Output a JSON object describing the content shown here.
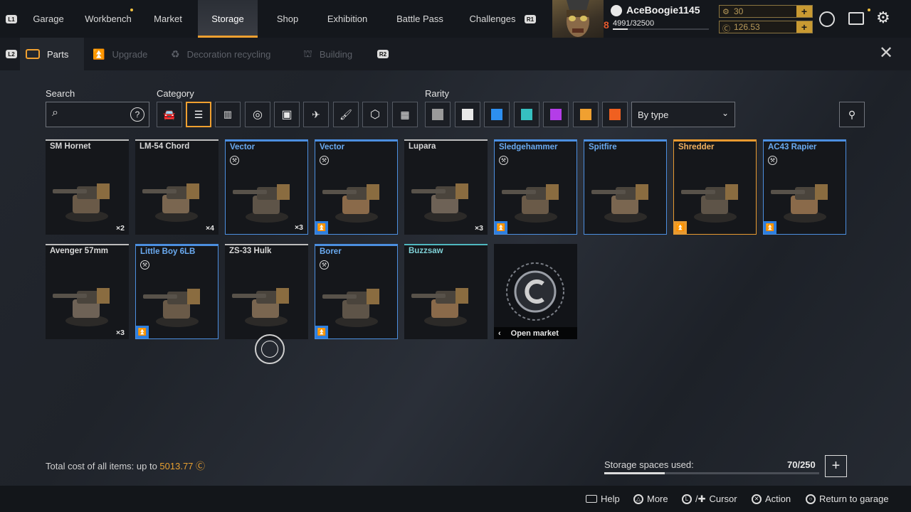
{
  "topnav": {
    "l1": "L1",
    "r1": "R1",
    "tabs": [
      "Garage",
      "Workbench",
      "Market",
      "Storage",
      "Shop",
      "Exhibition",
      "Battle Pass",
      "Challenges"
    ],
    "active": "Storage"
  },
  "player": {
    "name": "AceBoogie1145",
    "level": "8",
    "xp": "4991/32500",
    "coins": "30",
    "credits": "126.53"
  },
  "subnav": {
    "l2": "L2",
    "r2": "R2",
    "tabs": [
      "Parts",
      "Upgrade",
      "Decoration recycling",
      "Building"
    ],
    "active": "Parts"
  },
  "filters": {
    "search_label": "Search",
    "category_label": "Category",
    "rarity_label": "Rarity",
    "sort_value": "By type",
    "rarity_colors": [
      "#9a9a9a",
      "#e8e8e8",
      "#2d8ff0",
      "#36c0c0",
      "#b43de8",
      "#f0a030",
      "#f06020"
    ]
  },
  "items": [
    {
      "name": "SM Hornet",
      "rarity": "common",
      "qty": "×2",
      "craft": false,
      "rank": false
    },
    {
      "name": "LM-54 Chord",
      "rarity": "common",
      "qty": "×4",
      "craft": false,
      "rank": false
    },
    {
      "name": "Vector",
      "rarity": "blue",
      "qty": "×3",
      "craft": true,
      "rank": false
    },
    {
      "name": "Vector",
      "rarity": "blue",
      "qty": "",
      "craft": true,
      "rank": true
    },
    {
      "name": "Lupara",
      "rarity": "common",
      "qty": "×3",
      "craft": false,
      "rank": false
    },
    {
      "name": "Sledgehammer",
      "rarity": "blue",
      "qty": "",
      "craft": true,
      "rank": true
    },
    {
      "name": "Spitfire",
      "rarity": "blue",
      "qty": "",
      "craft": false,
      "rank": false
    },
    {
      "name": "Shredder",
      "rarity": "orange",
      "qty": "",
      "craft": false,
      "rank": true
    },
    {
      "name": "AC43 Rapier",
      "rarity": "blue",
      "qty": "",
      "craft": true,
      "rank": true
    },
    {
      "name": "Avenger 57mm",
      "rarity": "common",
      "qty": "×3",
      "craft": false,
      "rank": false
    },
    {
      "name": "Little Boy 6LB",
      "rarity": "blue",
      "qty": "",
      "craft": true,
      "rank": true
    },
    {
      "name": "ZS-33 Hulk",
      "rarity": "common",
      "qty": "",
      "craft": false,
      "rank": false
    },
    {
      "name": "Borer",
      "rarity": "blue",
      "qty": "",
      "craft": true,
      "rank": true
    },
    {
      "name": "Buzzsaw",
      "rarity": "teal",
      "qty": "",
      "craft": false,
      "rank": false
    }
  ],
  "open_market": "Open market",
  "footer": {
    "total_cost_label": "Total cost of all items: up to",
    "total_cost_value": "5013.77",
    "storage_label": "Storage spaces used:",
    "storage_value": "70/250",
    "storage_fraction": 0.28
  },
  "hints": {
    "help": "Help",
    "more": "More",
    "cursor": "Cursor",
    "action": "Action",
    "return": "Return to garage"
  }
}
